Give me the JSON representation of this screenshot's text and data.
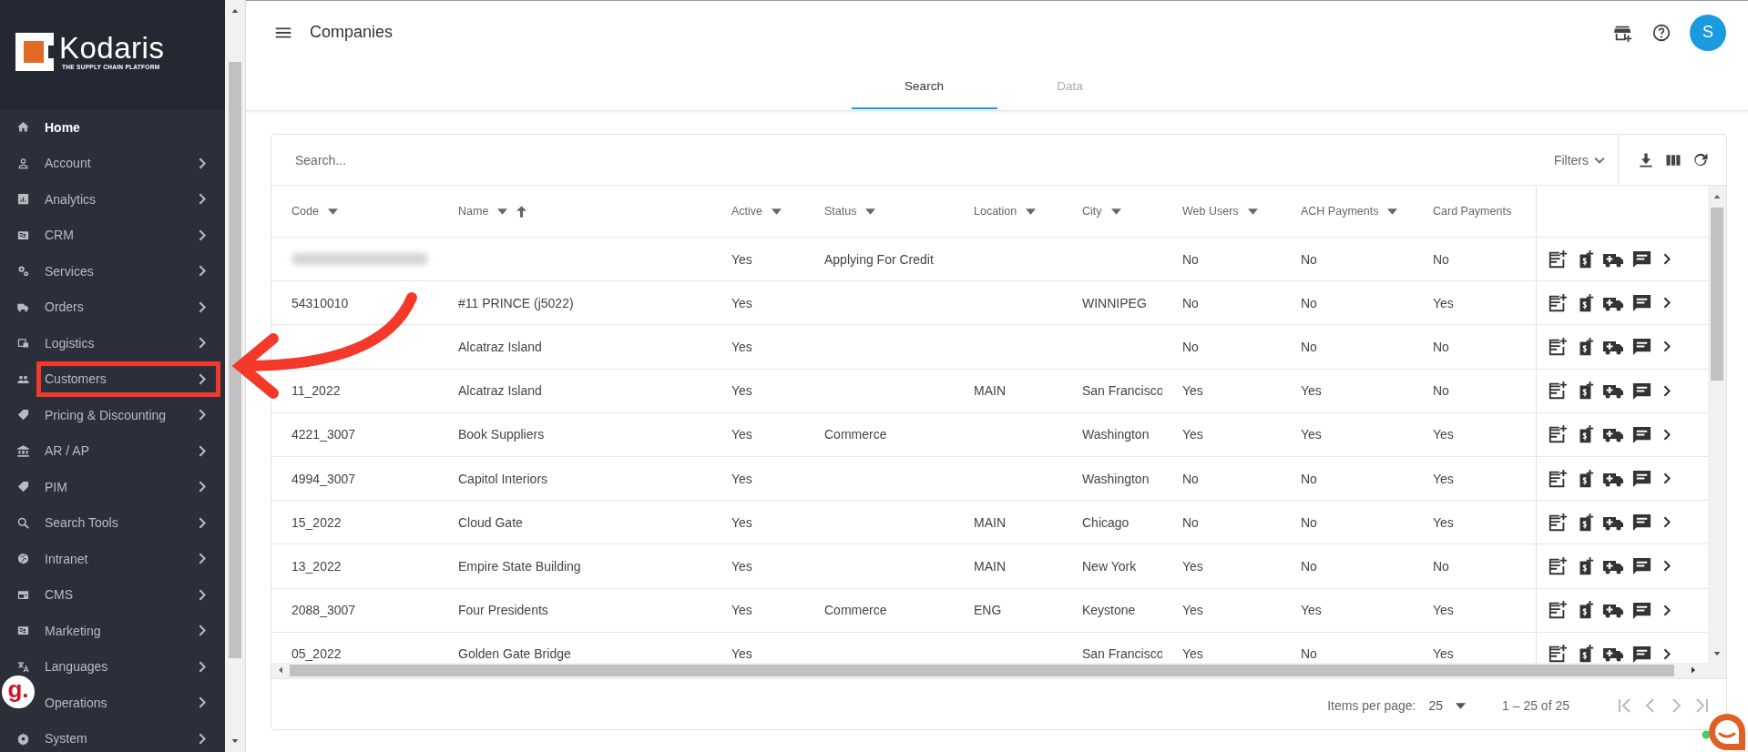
{
  "brand": {
    "name": "Kodaris",
    "tagline": "THE SUPPLY CHAIN PLATFORM"
  },
  "sidebar": {
    "items": [
      {
        "label": "Home",
        "selected": true,
        "expandable": false,
        "highlighted": false
      },
      {
        "label": "Account",
        "selected": false,
        "expandable": true,
        "highlighted": false
      },
      {
        "label": "Analytics",
        "selected": false,
        "expandable": true,
        "highlighted": false
      },
      {
        "label": "CRM",
        "selected": false,
        "expandable": true,
        "highlighted": false
      },
      {
        "label": "Services",
        "selected": false,
        "expandable": true,
        "highlighted": false
      },
      {
        "label": "Orders",
        "selected": false,
        "expandable": true,
        "highlighted": false
      },
      {
        "label": "Logistics",
        "selected": false,
        "expandable": true,
        "highlighted": false
      },
      {
        "label": "Customers",
        "selected": false,
        "expandable": true,
        "highlighted": true
      },
      {
        "label": "Pricing & Discounting",
        "selected": false,
        "expandable": true,
        "highlighted": false
      },
      {
        "label": "AR / AP",
        "selected": false,
        "expandable": true,
        "highlighted": false
      },
      {
        "label": "PIM",
        "selected": false,
        "expandable": true,
        "highlighted": false
      },
      {
        "label": "Search Tools",
        "selected": false,
        "expandable": true,
        "highlighted": false
      },
      {
        "label": "Intranet",
        "selected": false,
        "expandable": true,
        "highlighted": false
      },
      {
        "label": "CMS",
        "selected": false,
        "expandable": true,
        "highlighted": false
      },
      {
        "label": "Marketing",
        "selected": false,
        "expandable": true,
        "highlighted": false
      },
      {
        "label": "Languages",
        "selected": false,
        "expandable": true,
        "highlighted": false
      },
      {
        "label": "Operations",
        "selected": false,
        "expandable": true,
        "highlighted": false
      },
      {
        "label": "System",
        "selected": false,
        "expandable": true,
        "highlighted": false
      }
    ]
  },
  "widget_badge": "g.",
  "header": {
    "title": "Companies",
    "avatar": "S",
    "tabs": [
      {
        "label": "Search",
        "selected": true
      },
      {
        "label": "Data",
        "selected": false
      }
    ]
  },
  "table": {
    "search": {
      "placeholder": "Search..."
    },
    "filters": "Filters",
    "columns": [
      {
        "label": "Code",
        "menu": true,
        "sort_ascending": false
      },
      {
        "label": "Name",
        "menu": true,
        "sort_ascending": true
      },
      {
        "label": "Active",
        "menu": true,
        "sort_ascending": false
      },
      {
        "label": "Status",
        "menu": true,
        "sort_ascending": false
      },
      {
        "label": "Location",
        "menu": true,
        "sort_ascending": false
      },
      {
        "label": "City",
        "menu": true,
        "sort_ascending": false
      },
      {
        "label": "Web Users",
        "menu": true,
        "sort_ascending": false
      },
      {
        "label": "ACH Payments",
        "menu": true,
        "sort_ascending": false
      },
      {
        "label": "Card Payments",
        "menu": false,
        "sort_ascending": false
      }
    ],
    "rows": [
      {
        "redacted": true,
        "cells": [
          null,
          null,
          "Yes",
          "Applying For Credit",
          null,
          null,
          "No",
          "No",
          "No"
        ]
      },
      {
        "redacted": false,
        "cells": [
          "54310010",
          "#11 PRINCE (j5022)",
          "Yes",
          null,
          null,
          "WINNIPEG",
          "No",
          "No",
          "Yes"
        ]
      },
      {
        "redacted": false,
        "cells": [
          null,
          "Alcatraz Island",
          "Yes",
          null,
          null,
          null,
          "No",
          "No",
          "No"
        ]
      },
      {
        "redacted": false,
        "cells": [
          "11_2022",
          "Alcatraz Island",
          "Yes",
          null,
          "MAIN",
          "San Francisco",
          "Yes",
          "Yes",
          "No"
        ]
      },
      {
        "redacted": false,
        "cells": [
          "4221_3007",
          "Book Suppliers",
          "Yes",
          "Commerce",
          null,
          "Washington",
          "Yes",
          "Yes",
          "Yes"
        ]
      },
      {
        "redacted": false,
        "cells": [
          "4994_3007",
          "Capitol Interiors",
          "Yes",
          null,
          null,
          "Washington",
          "No",
          "No",
          "Yes"
        ]
      },
      {
        "redacted": false,
        "cells": [
          "15_2022",
          "Cloud Gate",
          "Yes",
          null,
          "MAIN",
          "Chicago",
          "No",
          "No",
          "Yes"
        ]
      },
      {
        "redacted": false,
        "cells": [
          "13_2022",
          "Empire State Building",
          "Yes",
          null,
          "MAIN",
          "New York",
          "Yes",
          "No",
          "No"
        ]
      },
      {
        "redacted": false,
        "cells": [
          "2088_3007",
          "Four Presidents",
          "Yes",
          "Commerce",
          "ENG",
          "Keystone",
          "Yes",
          "Yes",
          "Yes"
        ]
      },
      {
        "redacted": false,
        "cells": [
          "05_2022",
          "Golden Gate Bridge",
          "Yes",
          null,
          null,
          "San Francisco",
          "Yes",
          "No",
          "Yes"
        ]
      }
    ],
    "pager": {
      "label": "Items per page:",
      "page_size": "25",
      "range": "1 – 25 of 25",
      "nav": [
        {
          "kind": "first",
          "disabled": true
        },
        {
          "kind": "previous",
          "disabled": true
        },
        {
          "kind": "next",
          "disabled": true
        },
        {
          "kind": "last",
          "disabled": true
        }
      ]
    }
  }
}
